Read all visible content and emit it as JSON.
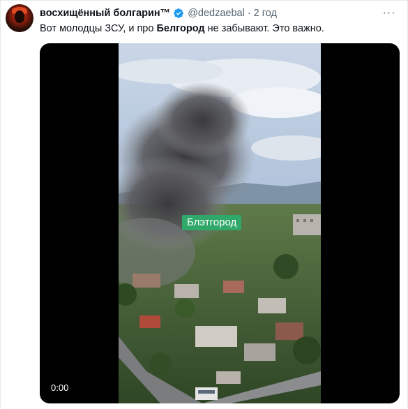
{
  "tweet": {
    "display_name": "восхищённый болгарин™",
    "handle": "@dedzaebal",
    "separator": "·",
    "time": "2 год",
    "more_label": "···",
    "text_before": "Вот молодцы ЗСУ, и про ",
    "text_bold": "Белгород",
    "text_after": " не забывают. Это важно."
  },
  "media": {
    "overlay_label": "Блэтгород",
    "video_time": "0:00"
  },
  "colors": {
    "verified": "#1d9bf0",
    "overlay_label_bg": "#2fa86a"
  }
}
